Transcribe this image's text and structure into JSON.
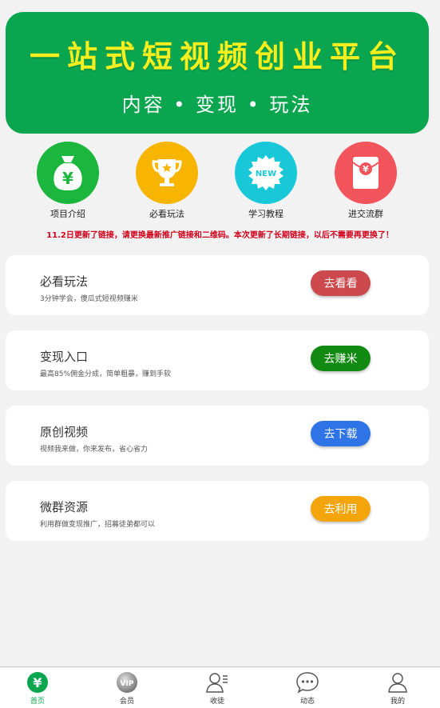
{
  "banner": {
    "title": "一站式短视频创业平台",
    "subtitle": "内容 • 变现 • 玩法"
  },
  "icons": [
    {
      "label": "项目介绍",
      "icon": "money-bag-icon",
      "color": "#1bb63d"
    },
    {
      "label": "必看玩法",
      "icon": "trophy-icon",
      "color": "#f7b500"
    },
    {
      "label": "学习教程",
      "icon": "new-badge-icon",
      "color": "#19c8d8"
    },
    {
      "label": "进交流群",
      "icon": "red-envelope-icon",
      "color": "#f2545b"
    }
  ],
  "notice": "11.2日更新了链接，请更换最新推广链接和二维码。本次更新了长期链接，以后不需要再更换了！",
  "cards": [
    {
      "title": "必看玩法",
      "desc": "3分钟学会，傻瓜式短视频赚米",
      "button": "去看看",
      "color": "#cc4a4e"
    },
    {
      "title": "变现入口",
      "desc": "最高85%佣金分成，简单粗暴，赚到手软",
      "button": "去赚米",
      "color": "#128a12"
    },
    {
      "title": "原创视频",
      "desc": "视频我来做，你来发布，省心省力",
      "button": "去下载",
      "color": "#2f74e6"
    },
    {
      "title": "微群资源",
      "desc": "利用群做变现推广，招募徒弟都可以",
      "button": "去利用",
      "color": "#f5a50c"
    }
  ],
  "tabbar": [
    {
      "label": "首页",
      "icon": "yuan-home-icon",
      "active": true
    },
    {
      "label": "会员",
      "icon": "vip-icon",
      "active": false
    },
    {
      "label": "收徒",
      "icon": "add-user-icon",
      "active": false
    },
    {
      "label": "动态",
      "icon": "chat-icon",
      "active": false
    },
    {
      "label": "我的",
      "icon": "user-icon",
      "active": false
    }
  ],
  "colors": {
    "accent": "#0aa64f",
    "banner_title": "#f6ee1e",
    "notice": "#d0021b"
  }
}
